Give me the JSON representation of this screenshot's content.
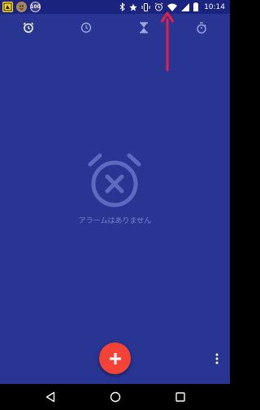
{
  "status_bar": {
    "time": "10:14",
    "notifications": [
      {
        "icon": "yellow-app-icon",
        "label": ""
      },
      {
        "icon": "game-app-icon",
        "label": ""
      },
      {
        "icon": "badge-100-icon",
        "label": "100"
      }
    ],
    "system_icons": [
      "bluetooth-icon",
      "star-icon",
      "vibrate-icon",
      "alarm-icon",
      "wifi-icon",
      "signal-icon",
      "battery-icon"
    ]
  },
  "tabs": [
    {
      "icon": "alarm-clock-icon",
      "active": true
    },
    {
      "icon": "clock-icon",
      "active": false
    },
    {
      "icon": "hourglass-timer-icon",
      "active": false
    },
    {
      "icon": "stopwatch-icon",
      "active": false
    }
  ],
  "empty_state": {
    "icon": "no-alarm-icon",
    "message": "アラームはありません"
  },
  "fab": {
    "icon": "plus-icon"
  },
  "overflow": {
    "icon": "more-vert-icon"
  },
  "annotation": {
    "icon": "red-arrow-icon",
    "color": "#e91e45"
  },
  "nav_bar": {
    "buttons": [
      "back-icon",
      "home-icon",
      "recents-icon"
    ]
  },
  "colors": {
    "background": "#283593",
    "status_bar": "#1a237e",
    "fab": "#f44336",
    "empty_text": "#7986cb",
    "empty_icon": "#5c6bc0"
  }
}
